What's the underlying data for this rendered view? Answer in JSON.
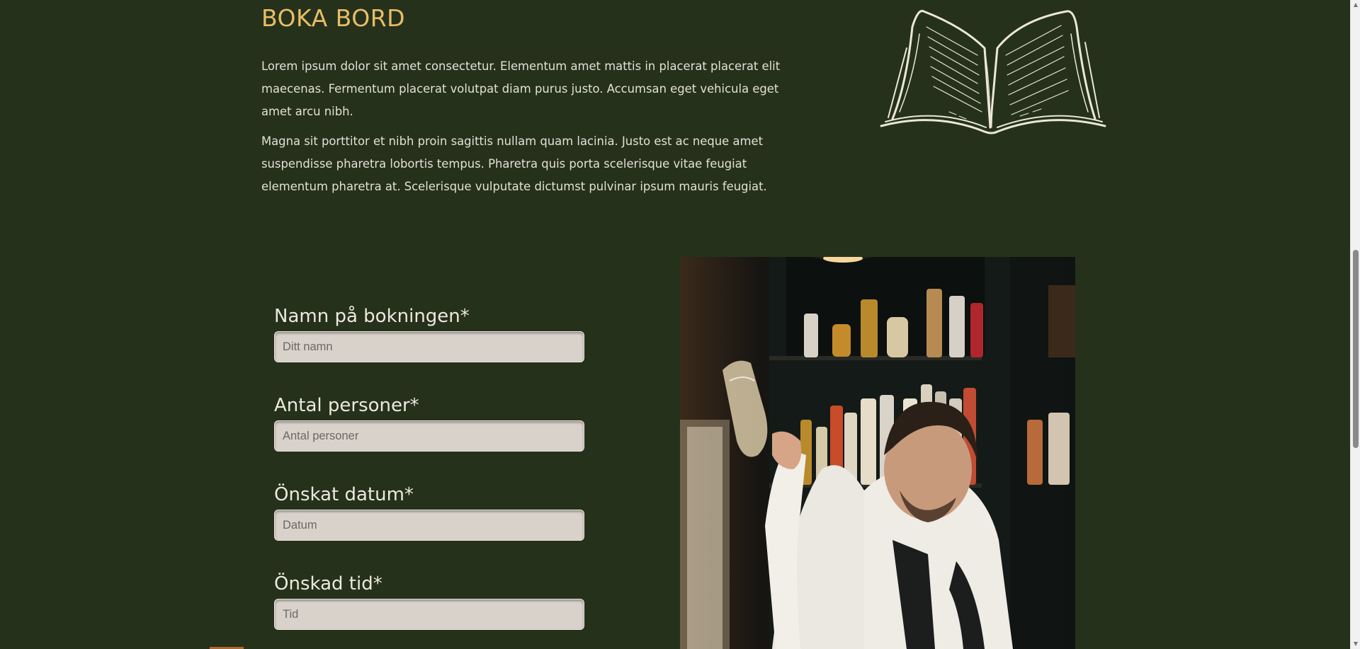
{
  "section": {
    "title": "BOKA BORD",
    "paragraphs": [
      "Lorem ipsum dolor sit amet consectetur. Elementum amet mattis in placerat placerat elit maecenas. Fermentum placerat volutpat diam purus justo. Accumsan eget vehicula eget amet arcu nibh.",
      "Magna sit porttitor et nibh proin sagittis nullam quam lacinia. Justo est ac neque amet suspendisse pharetra lobortis tempus. Pharetra quis porta scelerisque vitae feugiat elementum pharetra at. Scelerisque vulputate dictumst pulvinar ipsum mauris feugiat."
    ]
  },
  "form": {
    "name": {
      "label": "Namn på bokningen*",
      "placeholder": "Ditt namn",
      "value": ""
    },
    "persons": {
      "label": "Antal personer*",
      "placeholder": "Antal personer",
      "value": ""
    },
    "date": {
      "label": "Önskat datum*",
      "placeholder": "Datum",
      "value": ""
    },
    "time": {
      "label": "Önskad tid*",
      "placeholder": "Tid",
      "value": ""
    }
  },
  "icons": {
    "book": "open-book-illustration-icon",
    "scroll_up": "chevron-up-icon",
    "scroll_down": "chevron-down-icon"
  },
  "colors": {
    "background": "#25311b",
    "heading": "#e8bd66",
    "text": "#e3e0d6",
    "input_background": "#d9d2cb"
  }
}
